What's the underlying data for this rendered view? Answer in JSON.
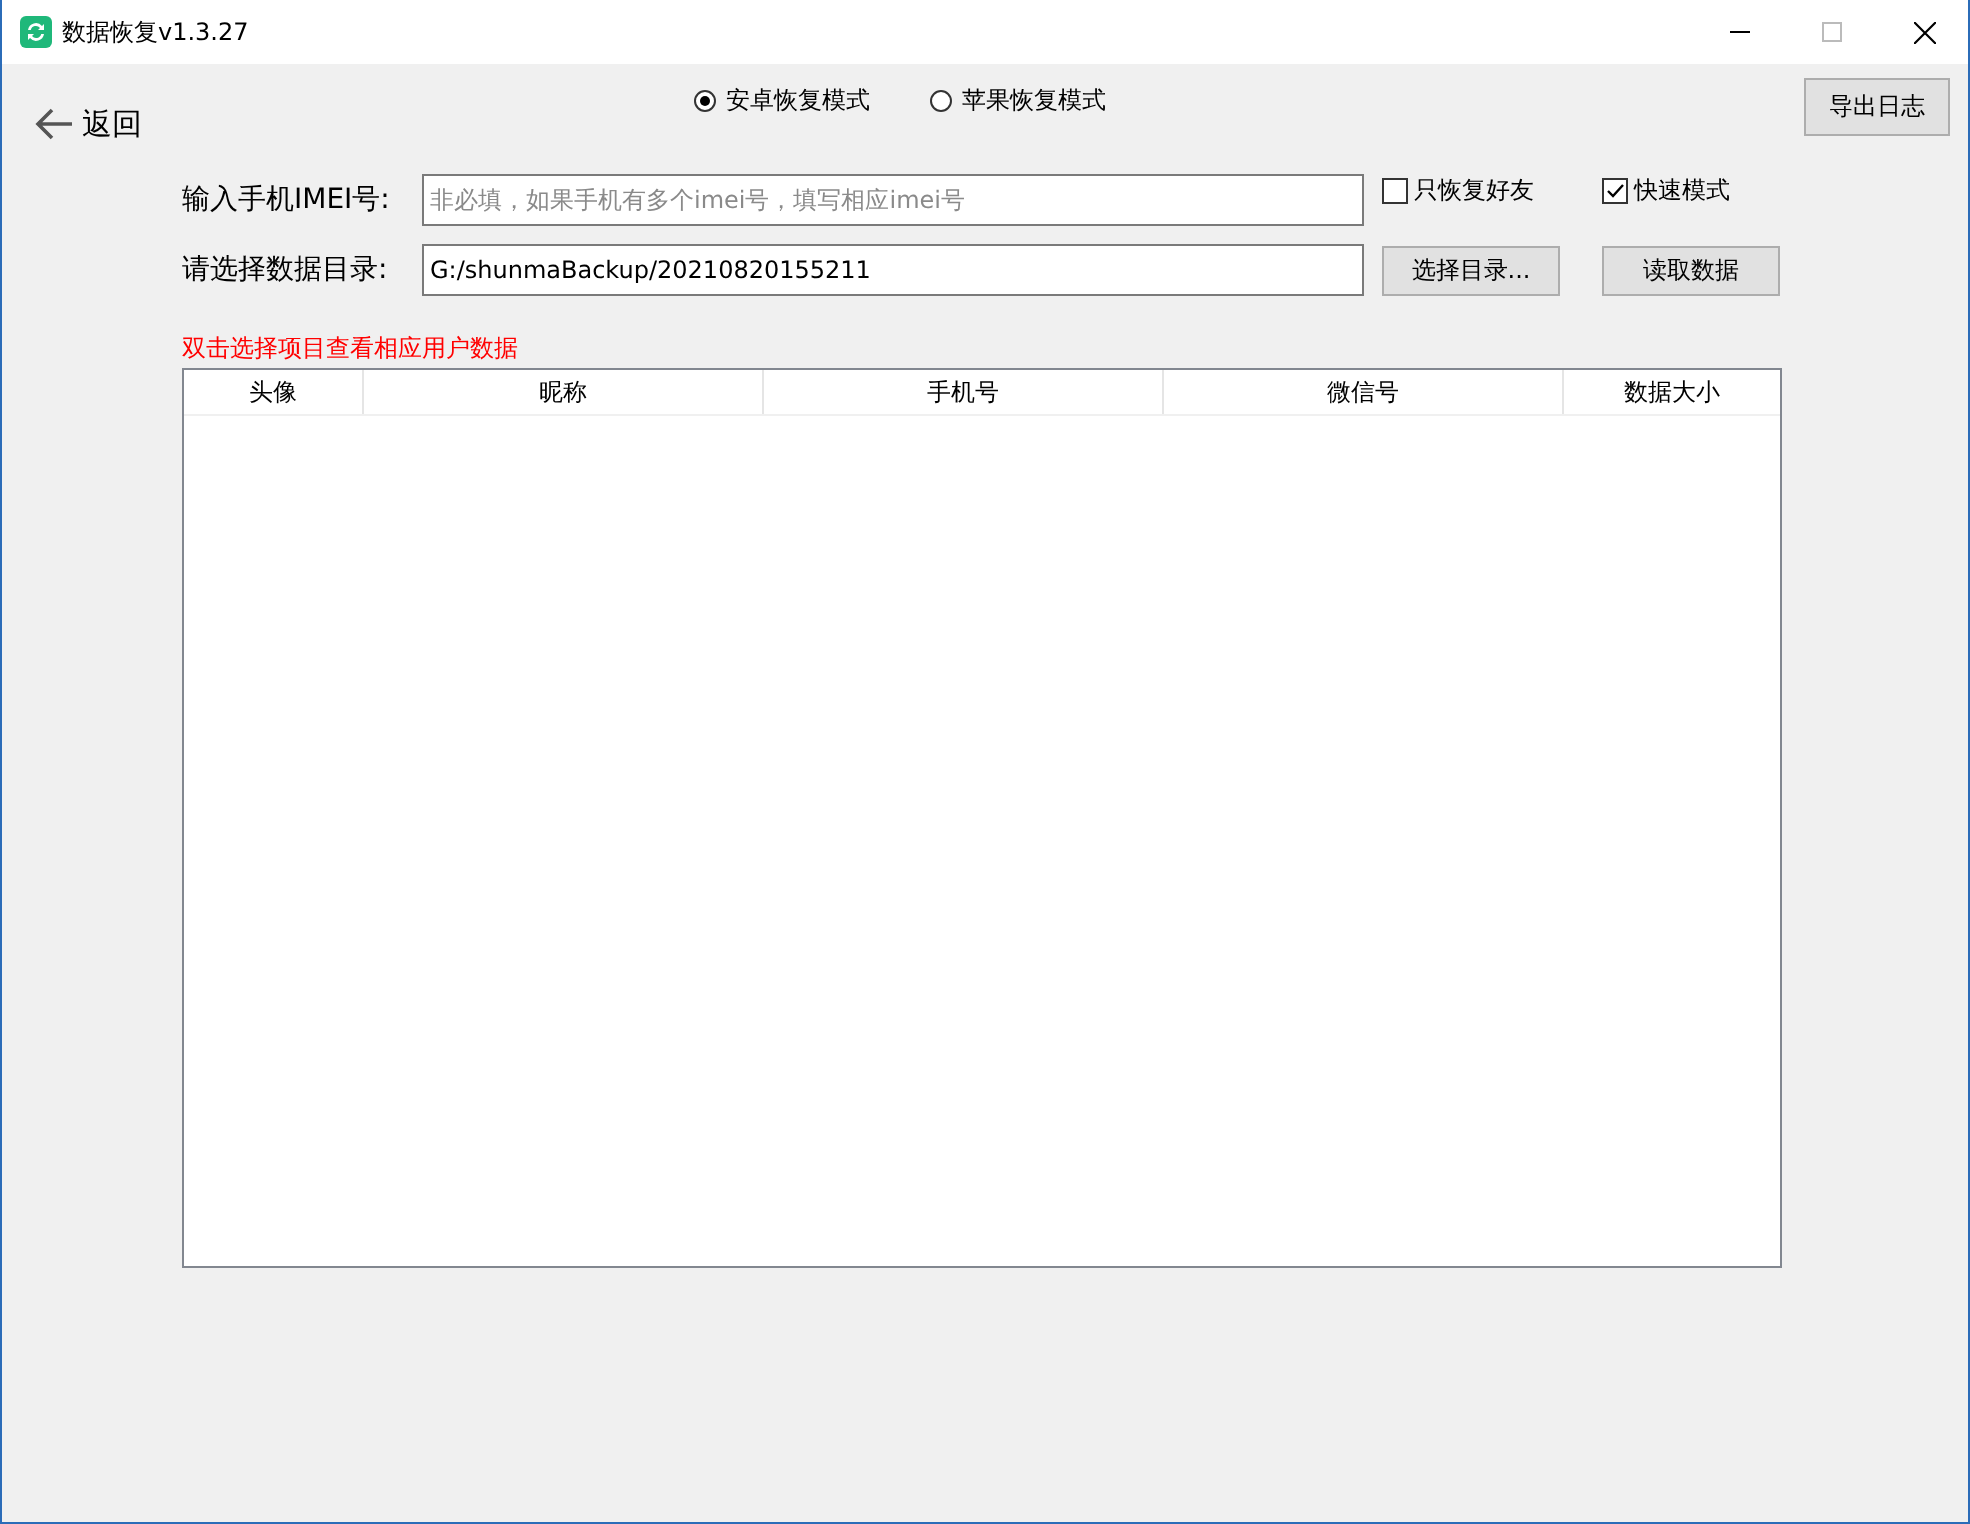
{
  "window": {
    "title": "数据恢复v1.3.27"
  },
  "back": {
    "label": "返回"
  },
  "modes": [
    {
      "label": "安卓恢复模式",
      "selected": true
    },
    {
      "label": "苹果恢复模式",
      "selected": false
    }
  ],
  "export_button": "导出日志",
  "imei": {
    "label": "输入手机IMEI号:",
    "placeholder": "非必填，如果手机有多个imei号，填写相应imei号"
  },
  "options": [
    {
      "label": "只恢复好友",
      "checked": false
    },
    {
      "label": "快速模式",
      "checked": true
    }
  ],
  "directory": {
    "label": "请选择数据目录:",
    "value": "G:/shunmaBackup/20210820155211"
  },
  "buttons": [
    "选择目录...",
    "读取数据"
  ],
  "hint": "双击选择项目查看相应用户数据",
  "table": {
    "columns": [
      "头像",
      "昵称",
      "手机号",
      "微信号",
      "数据大小"
    ]
  }
}
